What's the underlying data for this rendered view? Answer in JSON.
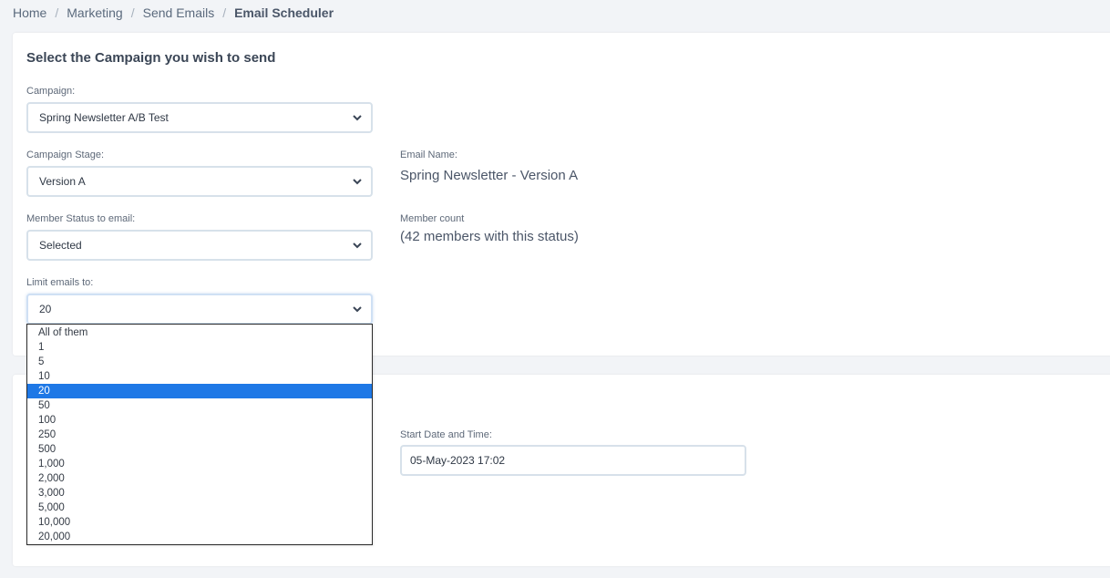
{
  "breadcrumb": {
    "items": [
      "Home",
      "Marketing",
      "Send Emails"
    ],
    "current": "Email Scheduler",
    "separator": "/"
  },
  "campaign_card": {
    "title": "Select the Campaign you wish to send",
    "campaign_label": "Campaign:",
    "campaign_value": "Spring Newsletter A/B Test",
    "stage_label": "Campaign Stage:",
    "stage_value": "Version A",
    "member_status_label": "Member Status to email:",
    "member_status_value": "Selected",
    "limit_label": "Limit emails to:",
    "limit_value": "20",
    "email_name_label": "Email Name:",
    "email_name_value": "Spring Newsletter - Version A",
    "member_count_label": "Member count",
    "member_count_value": "(42 members with this status)"
  },
  "schedule_card": {
    "start_label": "Start Date and Time:",
    "start_value": "05-May-2023 17:02"
  },
  "limit_dropdown": {
    "options": [
      "All of them",
      "1",
      "5",
      "10",
      "20",
      "50",
      "100",
      "250",
      "500",
      "1,000",
      "2,000",
      "3,000",
      "5,000",
      "10,000",
      "20,000"
    ],
    "selected": "20"
  },
  "colors": {
    "accent": "#2a86d8",
    "selected_option": "#1e78e6",
    "page_background": "#f2f4f7"
  },
  "icons": {
    "select_arrow": "chevron-down-icon"
  }
}
